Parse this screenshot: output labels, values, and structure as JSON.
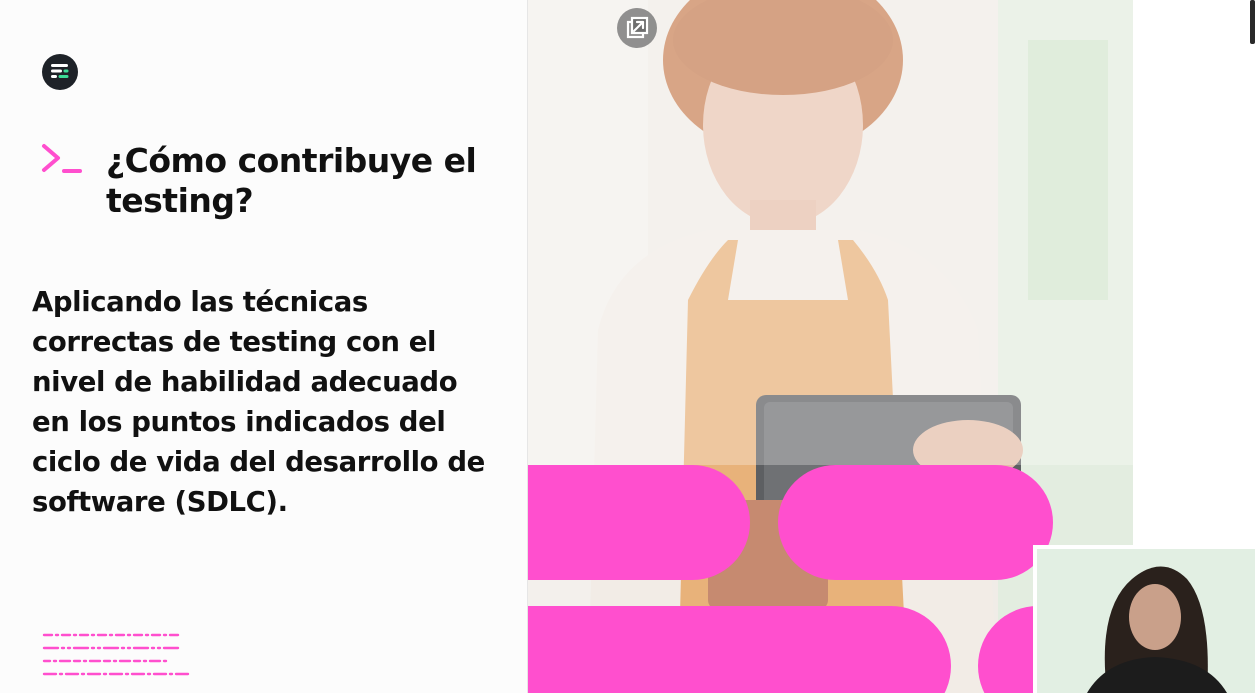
{
  "slide": {
    "title": "¿Cómo contribuye el testing?",
    "body": "Aplicando las técnicas correctas de testing con el nivel de habilidad adecuado en los puntos indicados del ciclo de vida del desarrollo de software (SDLC)."
  },
  "icons": {
    "logo": "platform-logo-icon",
    "prompt": "terminal-prompt-icon",
    "popout": "popout-window-icon"
  },
  "colors": {
    "accent_pink": "#ff4fce",
    "text_dark": "#111111",
    "logo_bg": "#1e2228"
  }
}
